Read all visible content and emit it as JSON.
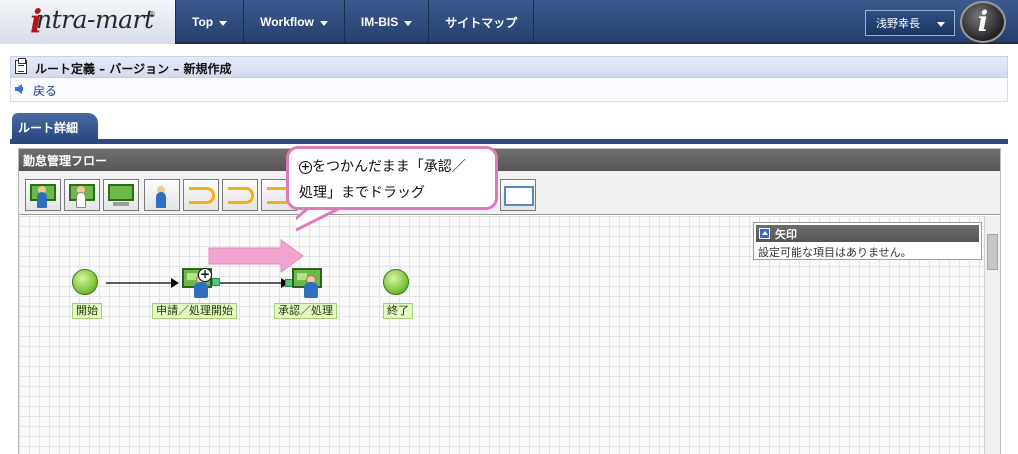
{
  "header": {
    "logo_text": "ntra-mart",
    "logo_initial": "i",
    "logo_reg": "®",
    "nav": [
      {
        "label": "Top",
        "has_caret": true
      },
      {
        "label": "Workflow",
        "has_caret": true
      },
      {
        "label": "IM-BIS",
        "has_caret": true
      },
      {
        "label": "サイトマップ",
        "has_caret": false
      }
    ],
    "user_name": "浅野幸長",
    "user_icon_letter": "i"
  },
  "page": {
    "title": "ルート定義 – バージョン – 新規作成",
    "back_label": "戻る",
    "tab_label": "ルート詳細"
  },
  "flow": {
    "title": "勤怠管理フロー",
    "nodes": {
      "start_label": "開始",
      "apply_label": "申請／処理開始",
      "approve_label": "承認／処理",
      "end_label": "終了"
    },
    "plus_glyph": "+"
  },
  "property_panel": {
    "title": "矢印",
    "message": "設定可能な項目はありません。"
  },
  "callout": {
    "line1_rest": "をつかんだまま「承認／",
    "line2": "処理」までドラッグ"
  },
  "colors": {
    "header_bg": "#2f4b7c",
    "accent_pink": "#e07ab9",
    "node_green": "#78c032"
  }
}
